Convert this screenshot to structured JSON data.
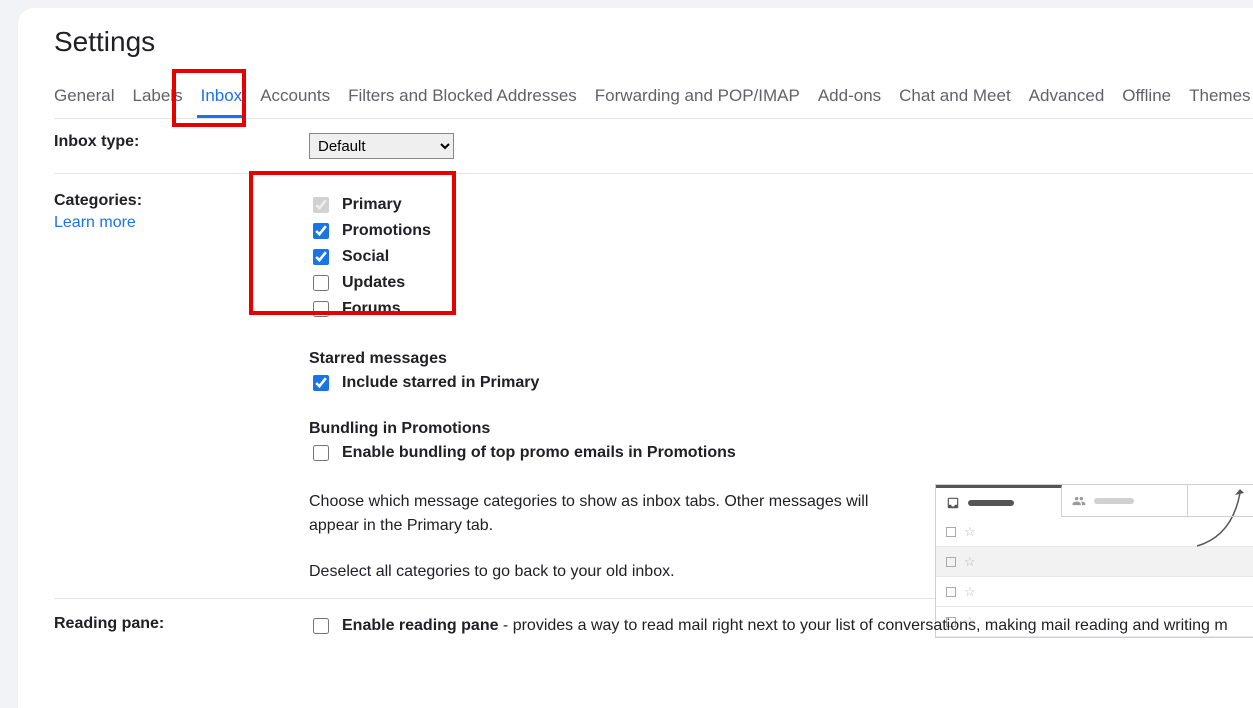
{
  "title": "Settings",
  "tabs": [
    "General",
    "Labels",
    "Inbox",
    "Accounts",
    "Filters and Blocked Addresses",
    "Forwarding and POP/IMAP",
    "Add-ons",
    "Chat and Meet",
    "Advanced",
    "Offline",
    "Themes"
  ],
  "activeTab": 2,
  "inboxType": {
    "label": "Inbox type:",
    "selected": "Default",
    "options": [
      "Default"
    ]
  },
  "categories": {
    "label": "Categories:",
    "learn": "Learn more",
    "items": [
      {
        "label": "Primary",
        "checked": true,
        "disabled": true
      },
      {
        "label": "Promotions",
        "checked": true,
        "disabled": false
      },
      {
        "label": "Social",
        "checked": true,
        "disabled": false
      },
      {
        "label": "Updates",
        "checked": false,
        "disabled": false
      },
      {
        "label": "Forums",
        "checked": false,
        "disabled": false
      }
    ],
    "starredHead": "Starred messages",
    "starred": {
      "label": "Include starred in Primary",
      "checked": true
    },
    "bundlingHead": "Bundling in Promotions",
    "bundling": {
      "label": "Enable bundling of top promo emails in Promotions",
      "checked": false
    },
    "para1": "Choose which message categories to show as inbox tabs. Other messages will appear in the Primary tab.",
    "para2": "Deselect all categories to go back to your old inbox."
  },
  "reading": {
    "label": "Reading pane:",
    "chk": {
      "label": "Enable reading pane",
      "checked": false
    },
    "desc": " - provides a way to read mail right next to your list of conversations, making mail reading and writing m"
  }
}
